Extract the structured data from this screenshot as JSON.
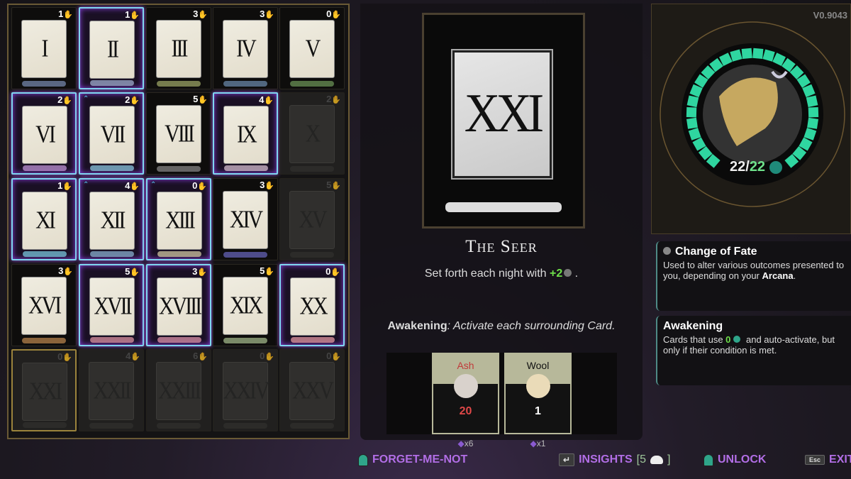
{
  "grid": {
    "cards": [
      {
        "numeral": "I",
        "cost": "1",
        "state": "normal",
        "band": "#7b8fb5"
      },
      {
        "numeral": "II",
        "cost": "1",
        "state": "active",
        "band": "#a7b5d8"
      },
      {
        "numeral": "III",
        "cost": "3",
        "state": "normal",
        "band": "#a3ad6a"
      },
      {
        "numeral": "IV",
        "cost": "3",
        "state": "normal",
        "band": "#6d8fb0"
      },
      {
        "numeral": "V",
        "cost": "0",
        "state": "normal",
        "band": "#6f9a5a"
      },
      {
        "numeral": "VI",
        "cost": "2",
        "state": "active",
        "band": "#c79ae0"
      },
      {
        "numeral": "VII",
        "cost": "2",
        "state": "active",
        "awakening": true,
        "band": "#8fd0e8"
      },
      {
        "numeral": "VIII",
        "cost": "5",
        "state": "normal",
        "band": "#8a8a8a"
      },
      {
        "numeral": "IX",
        "cost": "4",
        "state": "active",
        "band": "#e0c8d8"
      },
      {
        "numeral": "X",
        "cost": "2",
        "state": "locked"
      },
      {
        "numeral": "XI",
        "cost": "1",
        "state": "active",
        "band": "#7fd0e8"
      },
      {
        "numeral": "XII",
        "cost": "4",
        "state": "active",
        "awakening": true,
        "band": "#8fb8d8"
      },
      {
        "numeral": "XIII",
        "cost": "0",
        "state": "active",
        "awakening": true,
        "band": "#d8d0a8"
      },
      {
        "numeral": "XIV",
        "cost": "3",
        "state": "normal",
        "band": "#6a68c0"
      },
      {
        "numeral": "XV",
        "cost": "5",
        "state": "locked"
      },
      {
        "numeral": "XVI",
        "cost": "3",
        "state": "normal",
        "band": "#c08a50"
      },
      {
        "numeral": "XVII",
        "cost": "5",
        "state": "active",
        "band": "#e89aa8"
      },
      {
        "numeral": "XVIII",
        "cost": "3",
        "state": "active",
        "band": "#e89ab0"
      },
      {
        "numeral": "XIX",
        "cost": "5",
        "state": "normal",
        "band": "#a8c090"
      },
      {
        "numeral": "XX",
        "cost": "0",
        "state": "active",
        "band": "#f0a0a8"
      },
      {
        "numeral": "XXI",
        "cost": "0",
        "state": "locked",
        "selected": true
      },
      {
        "numeral": "XXII",
        "cost": "4",
        "state": "locked"
      },
      {
        "numeral": "XXIII",
        "cost": "6",
        "state": "locked"
      },
      {
        "numeral": "XXIV",
        "cost": "0",
        "state": "locked"
      },
      {
        "numeral": "XXV",
        "cost": "0",
        "state": "locked"
      }
    ]
  },
  "detail": {
    "numeral": "XXI",
    "name": "The Seer",
    "desc_prefix": "Set forth each night with ",
    "desc_bonus": "+2",
    "desc_suffix": " .",
    "awakening_label": "Awakening",
    "awakening_text": ": Activate each surrounding Card.",
    "costs": [
      {
        "name": "Ash",
        "amount": "20",
        "owned": "x6",
        "insufficient": true,
        "color": "#d9d2cc"
      },
      {
        "name": "Wool",
        "amount": "1",
        "owned": "x1",
        "insufficient": false,
        "color": "#eadbb8"
      }
    ]
  },
  "portrait": {
    "version": "V0.9043",
    "grasp_current": "22",
    "grasp_max": "22",
    "grasp_fill": 1.0,
    "ring_color": "#2fd6a0"
  },
  "info": [
    {
      "title": "Change of Fate",
      "text_prefix": "Used to alter various outcomes presented to you, depending on your ",
      "text_bold": "Arcana",
      "text_suffix": "."
    },
    {
      "title": "Awakening",
      "text_prefix": "Cards that use ",
      "text_green": "0",
      "text_suffix": " and auto-activate, but only if their condition is met."
    }
  ],
  "hints": {
    "forget": "FORGET-ME-NOT",
    "insights_key": "↵",
    "insights": "INSIGHTS",
    "insights_count": "[5",
    "insights_close": "]",
    "unlock": "UNLOCK",
    "exit_key": "Esc",
    "exit": "EXIT"
  }
}
